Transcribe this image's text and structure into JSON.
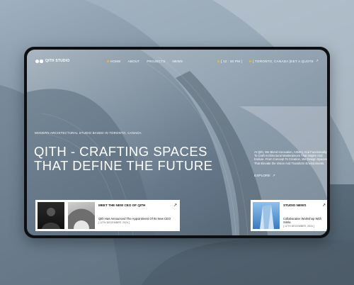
{
  "brand": {
    "name": "QITH STUDIO"
  },
  "nav": {
    "items": [
      {
        "label": "HOME",
        "active": true
      },
      {
        "label": "ABOUT",
        "active": false
      },
      {
        "label": "PROJECTS",
        "active": false
      },
      {
        "label": "NEWS",
        "active": false
      }
    ],
    "time": "[ 12 : 30 PM ]",
    "location": "[ TORONTO, CANADA ]",
    "cta": "GET A QUOTE"
  },
  "hero": {
    "tagline": "MODERN ARCHITECTURAL STUDIO BASED IN TORONTO, CANADA",
    "headline_line1": "QITH - CRAFTING  SPACES",
    "headline_line2": "THAT DEFINE THE FUTURE",
    "description": "At Qith, We Blend Innovation, Artistry, And Functionality To Craft Architectural Masterpieces That Inspire And Endure. From Concept To Creation, We Design Spaces That Elevate the Vision And Transform Environments.",
    "explore": "EXPLORE"
  },
  "cards": {
    "ceo": {
      "title": "MEET THE NEW CEO OF QITH",
      "text": "Qith Has Announced The Appointment Of Its New CEO",
      "date": "[ 12TH DECEMBER, 2024 ]"
    },
    "news": {
      "title": "STUDIO NEWS",
      "text": "Collaborative Workshop With Simla",
      "date": "[ 12TH DECEMBER, 2024 ]"
    }
  },
  "colors": {
    "accent": "#f2b33a",
    "text": "#ffffff"
  },
  "icons": {
    "arrow": "arrow-up-right-icon"
  }
}
